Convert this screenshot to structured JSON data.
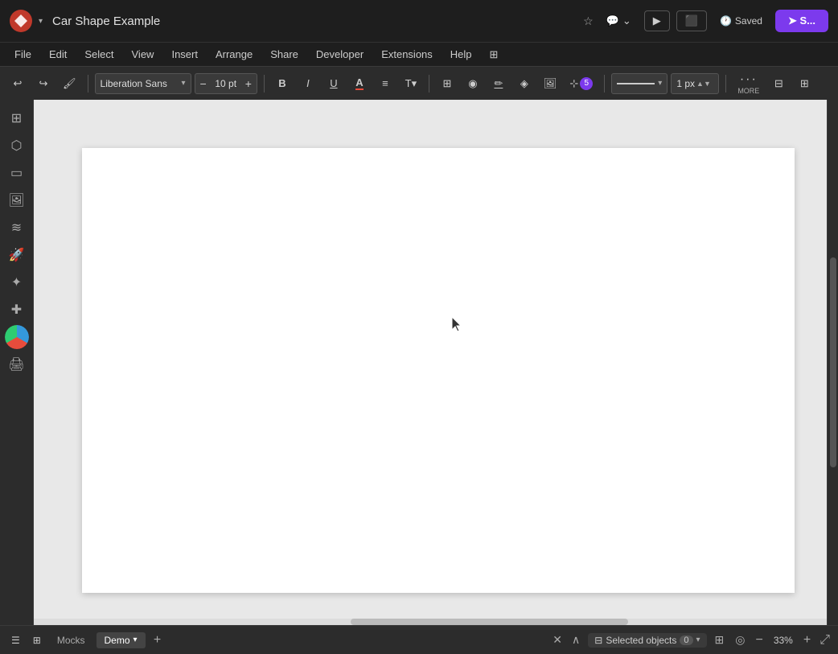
{
  "titlebar": {
    "logo": "L",
    "title": "Car Shape Example",
    "star_icon": "☆",
    "dropdown_arrow": "▾",
    "comment_icon": "💬",
    "expand_icon": "⌄",
    "present_icon": "▶",
    "screen_icon": "⬜",
    "save_label": "Saved",
    "share_label": "S..."
  },
  "menubar": {
    "items": [
      "File",
      "Edit",
      "Select",
      "View",
      "Insert",
      "Arrange",
      "Share",
      "Developer",
      "Extensions",
      "Help",
      "⊞"
    ]
  },
  "toolbar": {
    "undo_icon": "↩",
    "redo_icon": "↪",
    "paint_icon": "🖌",
    "font_name": "Liberation Sans",
    "font_size": "10",
    "font_size_unit": "pt",
    "bold_icon": "B",
    "italic_icon": "I",
    "underline_icon": "U",
    "text_color_icon": "A",
    "align_icon": "≡",
    "text_format_icon": "T",
    "add_box_icon": "⊞",
    "fill_icon": "◉",
    "line_color_icon": "✏",
    "gradient_icon": "◈",
    "image_icon": "🖼",
    "snap_icon": "⊹",
    "snap_badge": "5",
    "line_width": "1",
    "line_width_unit": "px",
    "more_label": "MORE",
    "panel_icon": "⊟",
    "grid_icon": "⊞"
  },
  "left_sidebar": {
    "icons": [
      "⊞",
      "⬡",
      "▭",
      "🖼",
      "≋",
      "🚀",
      "✦",
      "✚",
      "🌐",
      "🖨"
    ]
  },
  "canvas": {
    "background": "#e8e8e8",
    "page_bg": "#ffffff"
  },
  "bottombar": {
    "menu_icon": "☰",
    "grid_icon": "⊞",
    "tabs": [
      "Mocks"
    ],
    "active_tab": "Demo",
    "add_tab_icon": "+",
    "close_icon": "✕",
    "expand_icon": "∧",
    "selected_objects_icon": "⊟",
    "selected_objects_label": "Selected objects",
    "selected_objects_count": "0",
    "dropdown_icon": "▾",
    "layers_icon": "⊞",
    "search_icon": "◎",
    "zoom_out": "−",
    "zoom_percent": "33%",
    "zoom_in": "+",
    "fullscreen_icon": "⤢"
  }
}
